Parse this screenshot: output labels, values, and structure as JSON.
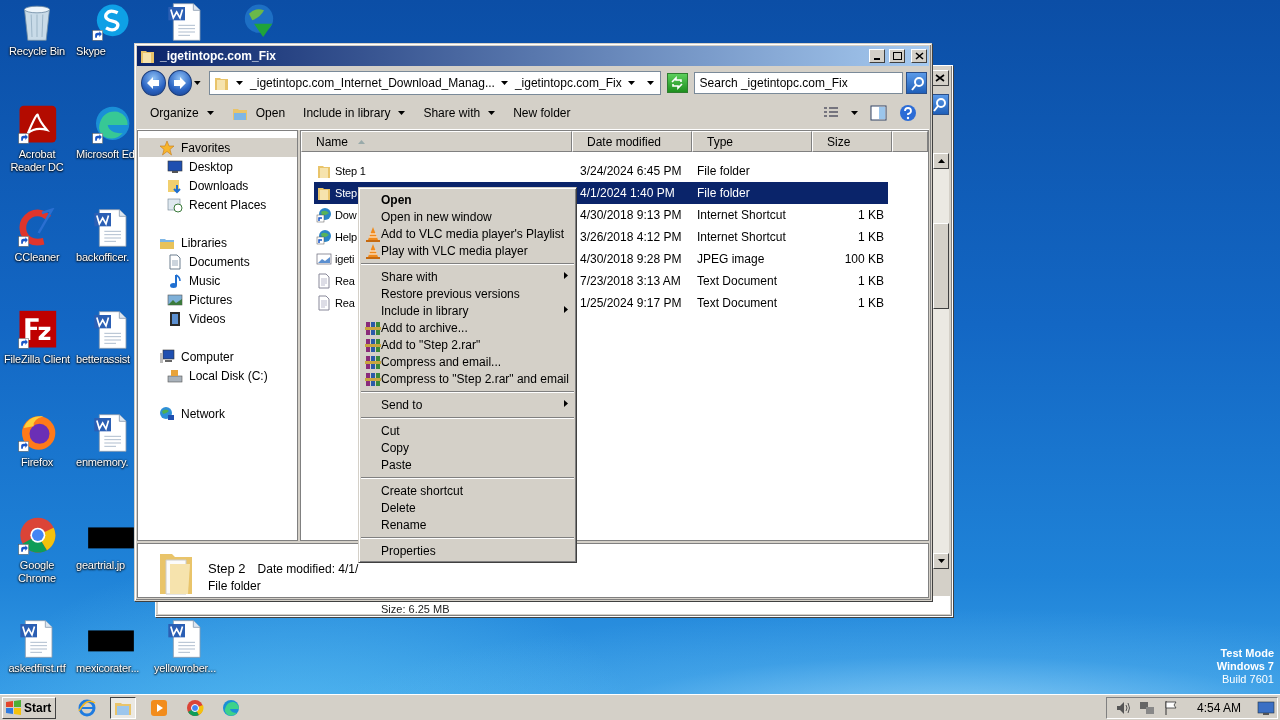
{
  "desktop": {
    "columns": [
      {
        "icons": [
          {
            "label": "Recycle Bin",
            "kind": "recycle"
          },
          {
            "label": "Acrobat Reader DC",
            "kind": "acrobat"
          },
          {
            "label": "CCleaner",
            "kind": "ccleaner"
          },
          {
            "label": "FileZilla Client",
            "kind": "filezilla"
          },
          {
            "label": "Firefox",
            "kind": "firefox"
          },
          {
            "label": "Google Chrome",
            "kind": "chrome"
          },
          {
            "label": "askedfirst.rtf",
            "kind": "word"
          }
        ]
      },
      {
        "icons": [
          {
            "label": "Skype",
            "kind": "skype"
          },
          {
            "label": "Microsoft Ed",
            "kind": "edge"
          },
          {
            "label": "backofficer.",
            "kind": "word"
          },
          {
            "label": "betterassist",
            "kind": "word"
          },
          {
            "label": "enmemory.",
            "kind": "word"
          },
          {
            "label": "geartrial.jp",
            "kind": "thumb"
          },
          {
            "label": "mexicorater...",
            "kind": "thumb"
          }
        ]
      },
      {
        "icons": [
          {
            "kind": "word"
          },
          {
            "label": "yellowrober...",
            "kind": "word"
          }
        ]
      },
      {
        "icons": [
          {
            "kind": "idm"
          }
        ]
      }
    ]
  },
  "back_window": {
    "status": "Size: 6.25 MB"
  },
  "explorer": {
    "title": "_igetintopc.com_Fix",
    "breadcrumbs": [
      "_igetintopc.com_Internet_Download_Manag...",
      "_igetintopc.com_Fix"
    ],
    "search": {
      "placeholder": "Search _igetintopc.com_Fix"
    },
    "toolbar": [
      {
        "label": "Organize",
        "kind": "menu"
      },
      {
        "label": "Open",
        "kind": "icon"
      },
      {
        "label": "Include in library",
        "kind": "menu"
      },
      {
        "label": "Share with",
        "kind": "menu"
      },
      {
        "label": "New folder",
        "kind": "plain"
      }
    ],
    "sidebar": [
      {
        "label": "Favorites",
        "kind": "star",
        "selected": true,
        "children": [
          {
            "label": "Desktop",
            "kind": "desktop",
            "selected": false
          },
          {
            "label": "Downloads",
            "kind": "downloads",
            "selected": false
          },
          {
            "label": "Recent Places",
            "kind": "recent",
            "selected": false
          }
        ]
      },
      {
        "label": "Libraries",
        "kind": "libraries",
        "selected": false,
        "children": [
          {
            "label": "Documents",
            "kind": "documents",
            "selected": false
          },
          {
            "label": "Music",
            "kind": "music",
            "selected": false
          },
          {
            "label": "Pictures",
            "kind": "pictures",
            "selected": false
          },
          {
            "label": "Videos",
            "kind": "videos",
            "selected": false
          }
        ]
      },
      {
        "label": "Computer",
        "kind": "computer",
        "selected": false,
        "children": [
          {
            "label": "Local Disk (C:)",
            "kind": "disk",
            "selected": false
          }
        ]
      },
      {
        "label": "Network",
        "kind": "network",
        "selected": false
      }
    ],
    "columns": [
      "Name",
      "Date modified",
      "Type",
      "Size"
    ],
    "rows": [
      {
        "name": "Step 1",
        "date": "3/24/2024 6:45 PM",
        "type": "File folder",
        "kind": "folder",
        "selected": false
      },
      {
        "name": "Step",
        "date": "4/1/2024 1:40 PM",
        "type": "File folder",
        "kind": "folder",
        "selected": true
      },
      {
        "name": "Dow",
        "date": "4/30/2018 9:13 PM",
        "type": "Internet Shortcut",
        "size": "1 KB",
        "kind": "shortcut",
        "selected": false
      },
      {
        "name": "Help",
        "date": "3/26/2018 4:12 PM",
        "type": "Internet Shortcut",
        "size": "1 KB",
        "kind": "shortcut",
        "selected": false
      },
      {
        "name": "igeti",
        "date": "4/30/2018 9:28 PM",
        "type": "JPEG image",
        "size": "100 KB",
        "kind": "image",
        "selected": false
      },
      {
        "name": "Rea",
        "date": "7/23/2018 3:13 AM",
        "type": "Text Document",
        "size": "1 KB",
        "kind": "text",
        "selected": false
      },
      {
        "name": "Rea",
        "date": "1/25/2024 9:17 PM",
        "type": "Text Document",
        "size": "1 KB",
        "kind": "text",
        "selected": false
      }
    ],
    "details": {
      "name": "Step 2",
      "modified": "Date modified: 4/1/",
      "type": "File folder"
    }
  },
  "context_menu": [
    {
      "kind": "plain",
      "label": "Open",
      "default": true,
      "submenu": false
    },
    {
      "kind": "plain",
      "label": "Open in new window",
      "default": false,
      "submenu": false
    },
    {
      "kind": "vlc",
      "label": "Add to VLC media player's Playlist",
      "default": false,
      "submenu": false
    },
    {
      "kind": "vlc",
      "label": "Play with VLC media player",
      "default": false,
      "submenu": false
    },
    {
      "kind": "separator"
    },
    {
      "kind": "plain",
      "label": "Share with",
      "default": false,
      "submenu": true
    },
    {
      "kind": "plain",
      "label": "Restore previous versions",
      "default": false,
      "submenu": false
    },
    {
      "kind": "plain",
      "label": "Include in library",
      "default": false,
      "submenu": true
    },
    {
      "kind": "rar",
      "label": "Add to archive...",
      "default": false,
      "submenu": false
    },
    {
      "kind": "rar",
      "label": "Add to \"Step 2.rar\"",
      "default": false,
      "submenu": false
    },
    {
      "kind": "rar",
      "label": "Compress and email...",
      "default": false,
      "submenu": false
    },
    {
      "kind": "rar",
      "label": "Compress to \"Step 2.rar\" and email",
      "default": false,
      "submenu": false
    },
    {
      "kind": "separator"
    },
    {
      "kind": "plain",
      "label": "Send to",
      "default": false,
      "submenu": true
    },
    {
      "kind": "separator"
    },
    {
      "kind": "plain",
      "label": "Cut",
      "default": false,
      "submenu": false
    },
    {
      "kind": "plain",
      "label": "Copy",
      "default": false,
      "submenu": false
    },
    {
      "kind": "plain",
      "label": "Paste",
      "default": false,
      "submenu": false
    },
    {
      "kind": "separator"
    },
    {
      "kind": "plain",
      "label": "Create shortcut",
      "default": false,
      "submenu": false
    },
    {
      "kind": "plain",
      "label": "Delete",
      "default": false,
      "submenu": false
    },
    {
      "kind": "plain",
      "label": "Rename",
      "default": false,
      "submenu": false
    },
    {
      "kind": "separator"
    },
    {
      "kind": "plain",
      "label": "Properties",
      "default": false,
      "submenu": false
    }
  ],
  "os_notice": [
    "Test Mode",
    "Windows 7",
    "Build 7601"
  ],
  "taskbar": {
    "start": "Start",
    "apps": [
      {
        "kind": "ie",
        "selected": false
      },
      {
        "kind": "explorer",
        "selected": true
      },
      {
        "kind": "media",
        "selected": false
      },
      {
        "kind": "chrome",
        "selected": false
      },
      {
        "kind": "edge",
        "selected": false
      }
    ],
    "tray": [
      {
        "kind": "speaker"
      },
      {
        "kind": "network"
      },
      {
        "kind": "flag"
      }
    ],
    "clock": "4:54 AM"
  }
}
